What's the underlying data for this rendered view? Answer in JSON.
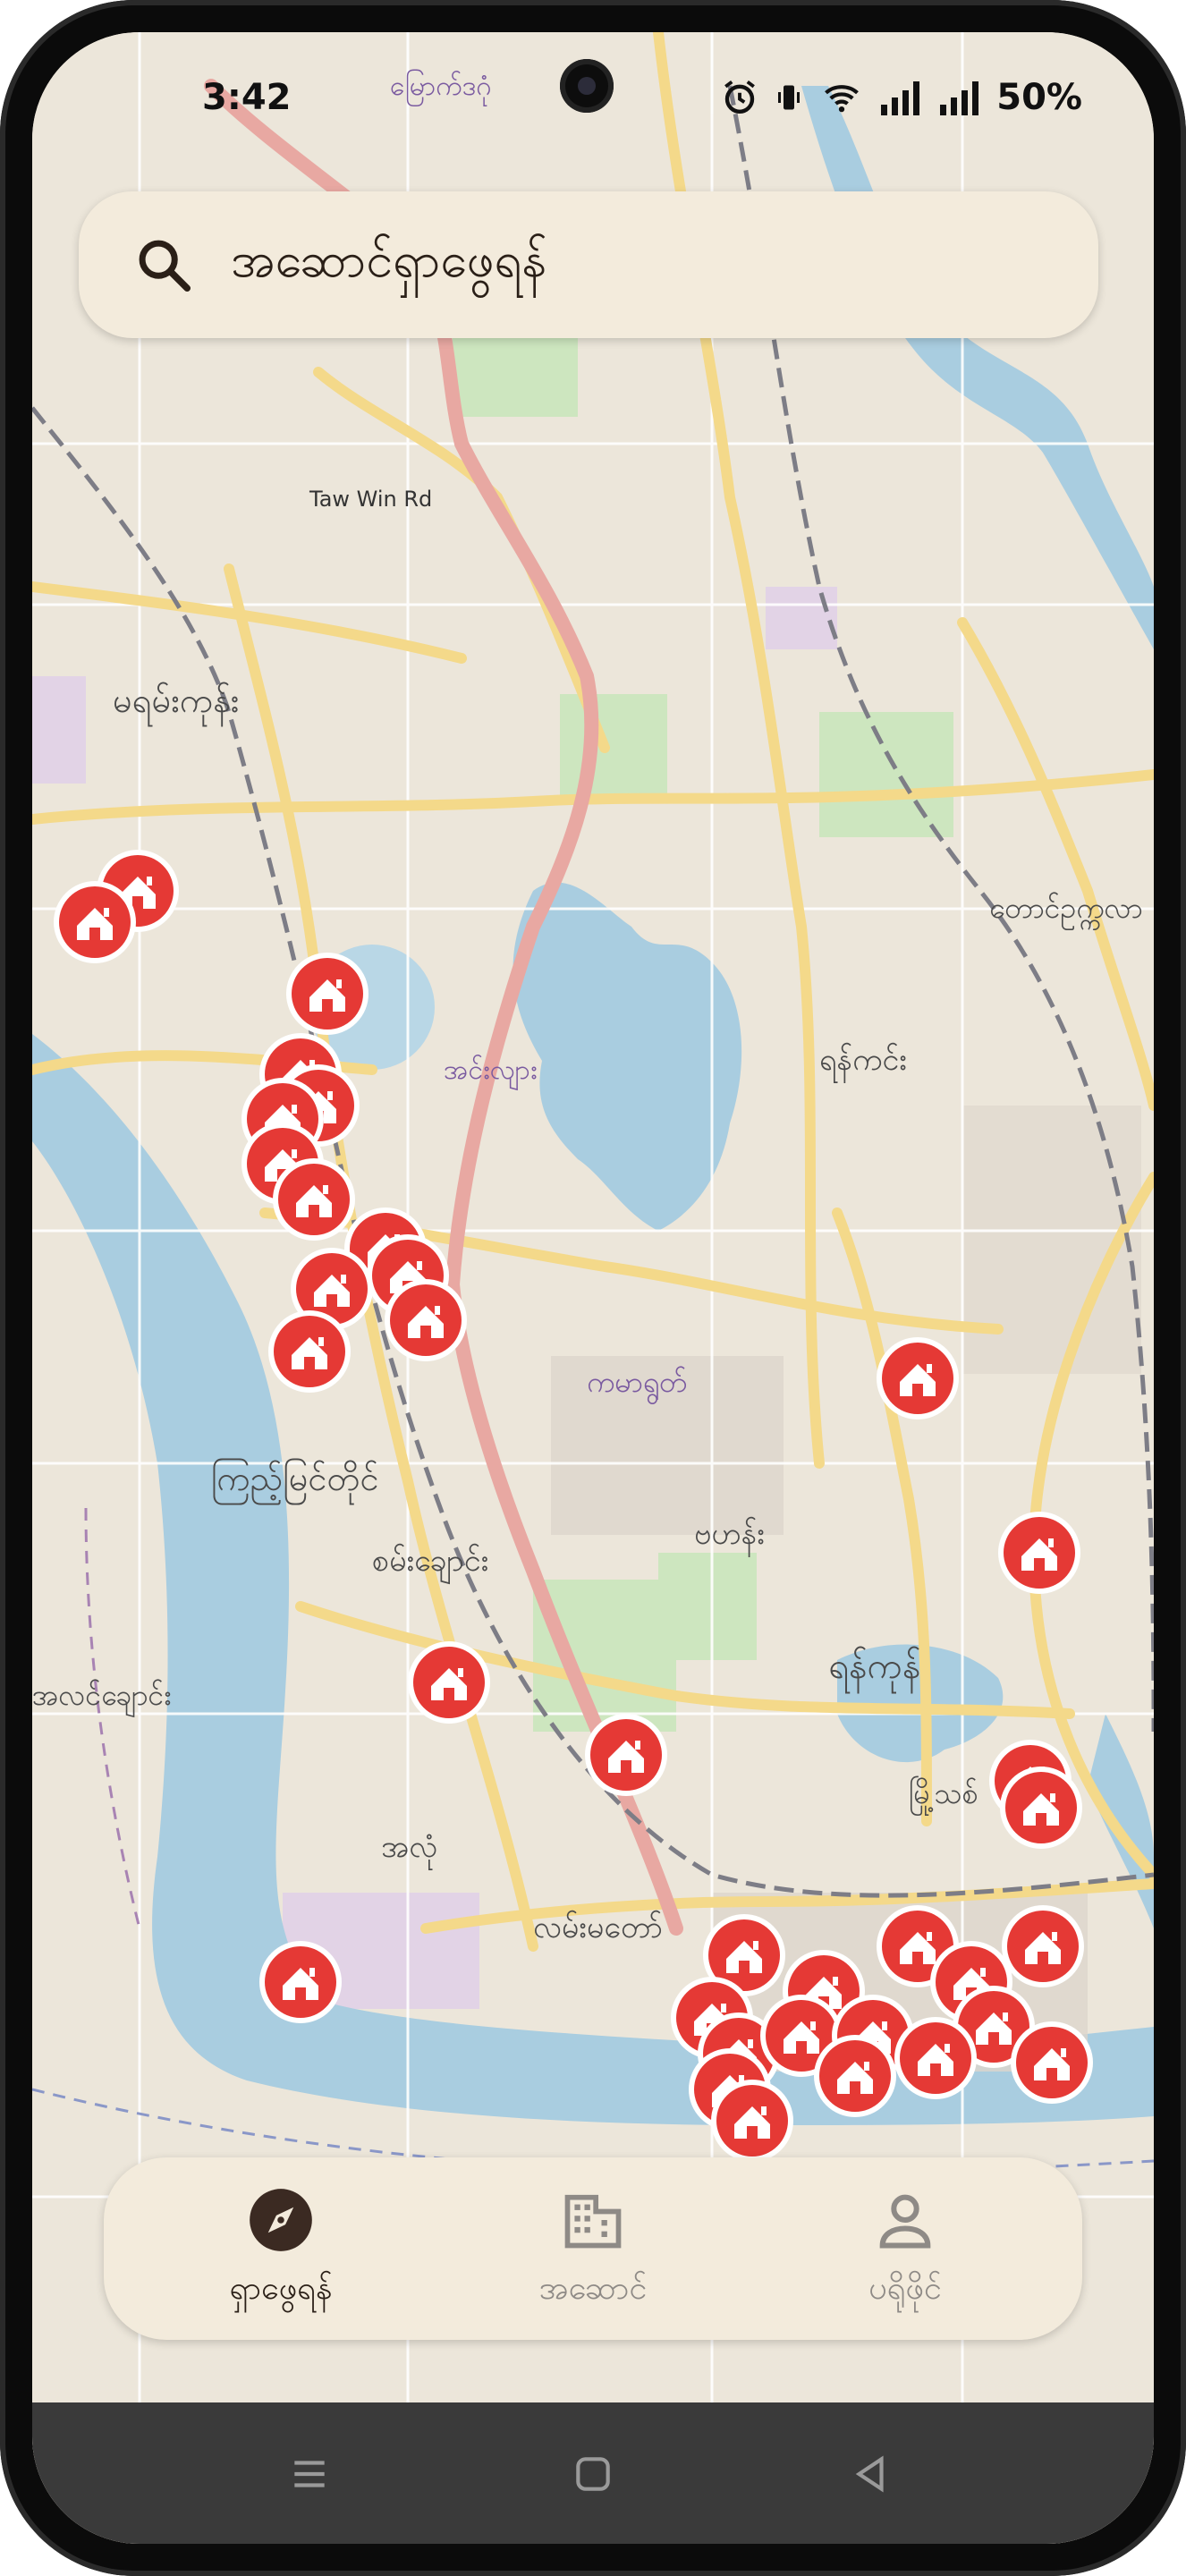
{
  "status_bar": {
    "time": "3:42",
    "battery": "50%"
  },
  "search": {
    "placeholder": "အဆောင်ရှာဖွေရန်"
  },
  "map": {
    "labels": [
      "မြောက်ဒဂုံ",
      "မရမ်းကုန်း",
      "ကြည့်မြင်တိုင်",
      "စမ်းချောင်း",
      "အလုံ",
      "ကမာရွတ်",
      "ဗဟန်း",
      "ရန်ကုန်",
      "လမ်းမတော်",
      "အင်းလျား",
      "ရန်ကင်း",
      "တောင်ဥက္ကလာ",
      "အလင်ချောင်း",
      "Taw Win Rd",
      "မြို့သစ်"
    ],
    "pin_icon": "house-marker-icon",
    "pin_color": "#e53935"
  },
  "bottom_nav": {
    "items": [
      {
        "label": "ရှာဖွေရန်",
        "icon": "compass-icon",
        "active": true
      },
      {
        "label": "အဆောင်",
        "icon": "building-icon",
        "active": false
      },
      {
        "label": "ပရိုဖိုင်",
        "icon": "person-icon",
        "active": false
      }
    ]
  }
}
